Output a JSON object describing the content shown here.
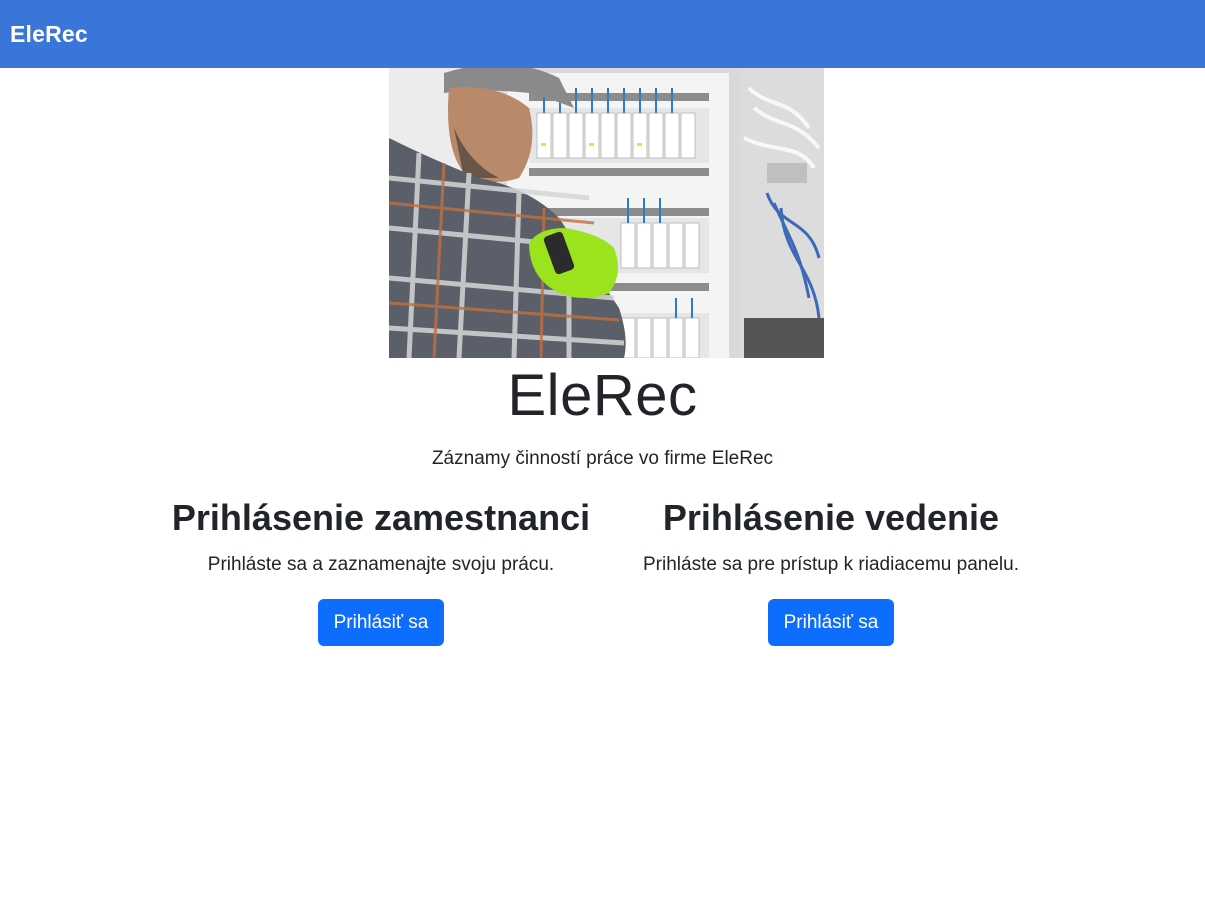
{
  "navbar": {
    "brand": "EleRec",
    "color": "#3a75d9"
  },
  "hero": {
    "image_icon": "electrician-photo"
  },
  "main": {
    "title": "EleRec",
    "subtitle": "Záznamy činností práce vo firme EleRec"
  },
  "employee": {
    "heading": "Prihlásenie zamestnanci",
    "text": "Prihláste sa a zaznamenajte svoju prácu.",
    "button_label": "Prihlásiť sa"
  },
  "management": {
    "heading": "Prihlásenie vedenie",
    "text": "Prihláste sa pre prístup k riadiacemu panelu.",
    "button_label": "Prihlásiť sa"
  },
  "colors": {
    "button": "#0d6efd",
    "text": "#212529"
  }
}
